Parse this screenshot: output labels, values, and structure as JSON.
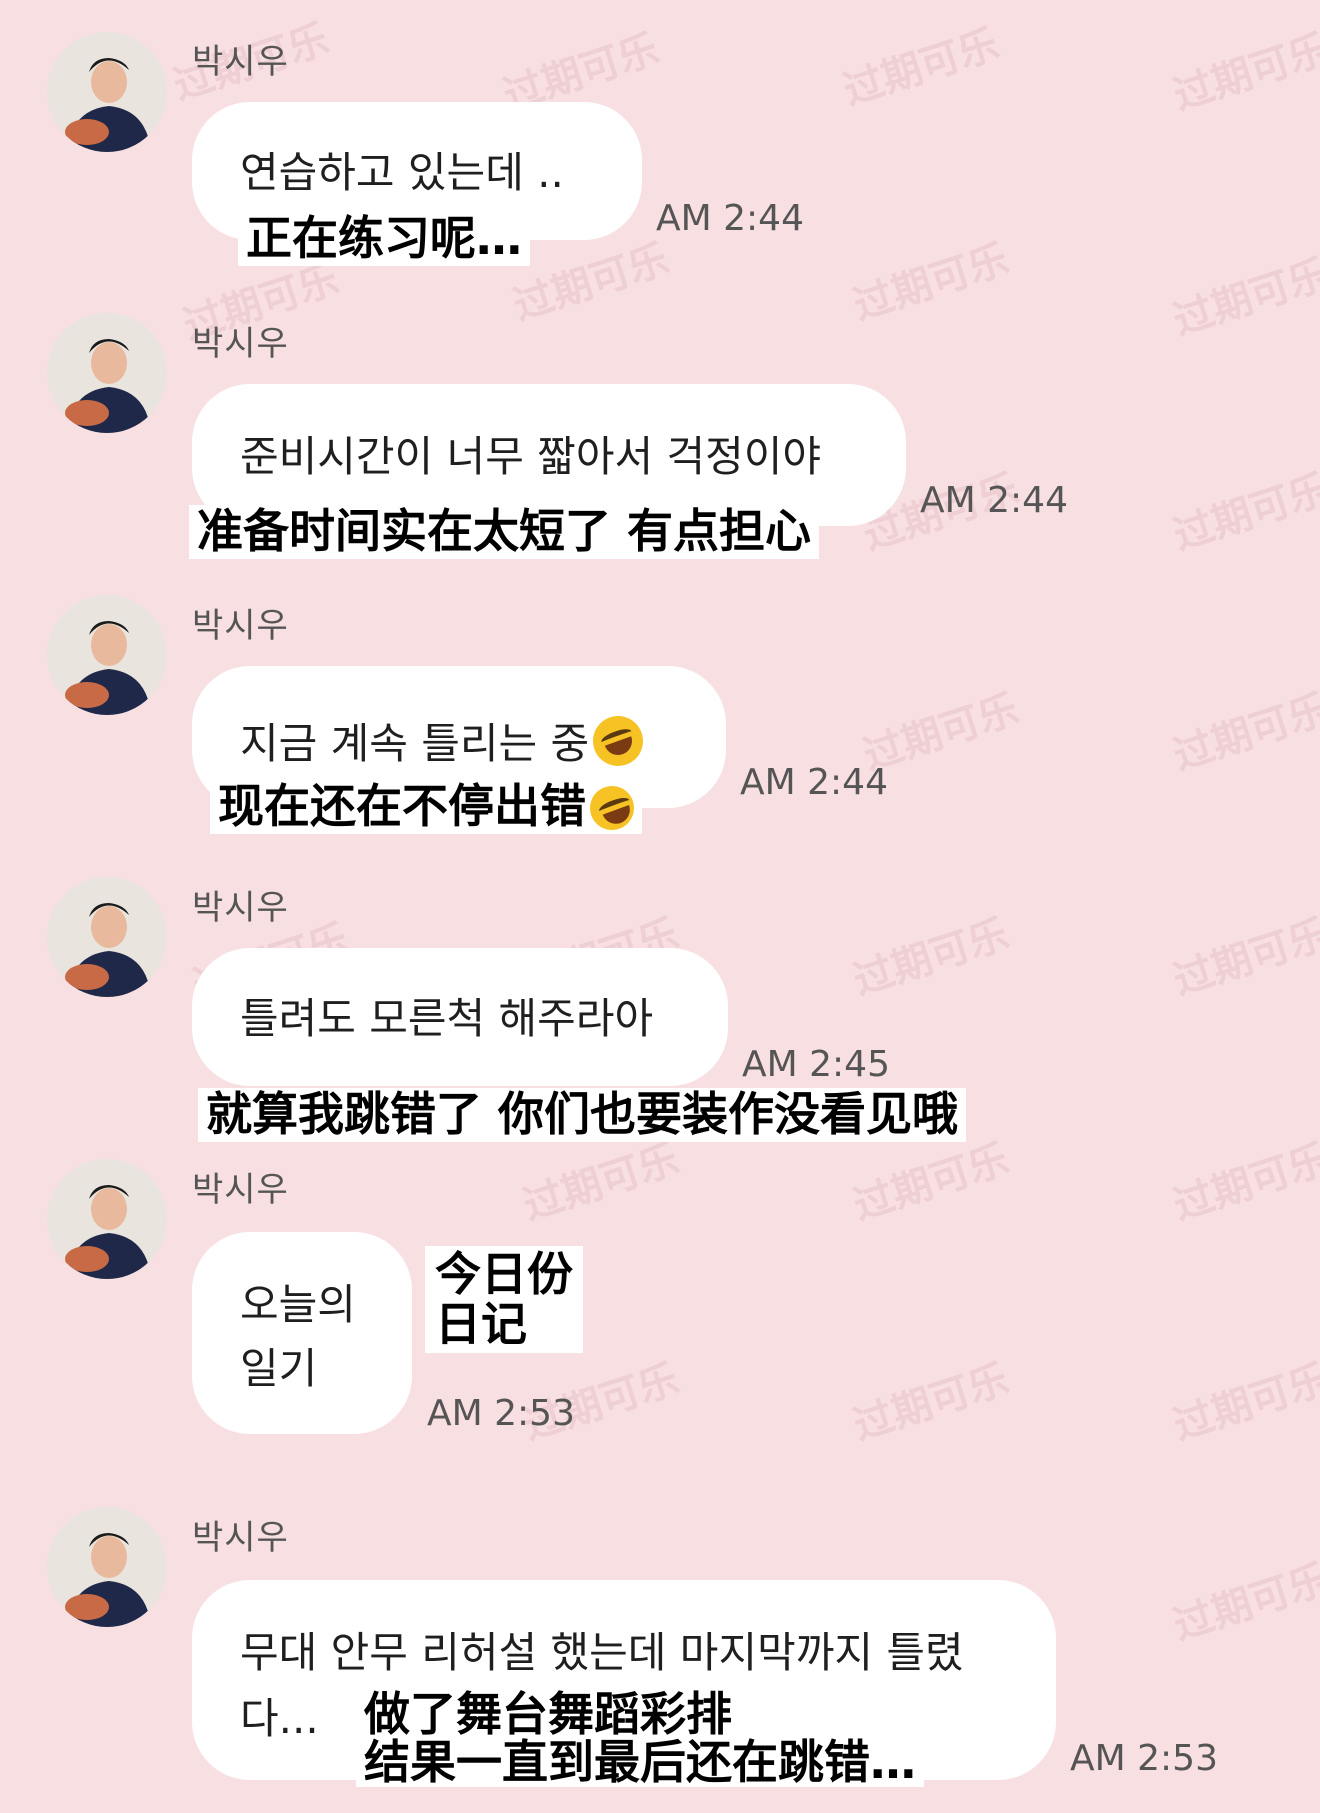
{
  "watermark": "过期可乐",
  "messages": [
    {
      "sender": "박시우",
      "ko": "연습하고 있는데 ..",
      "zh": "正在练习呢…",
      "time": "AM 2:44"
    },
    {
      "sender": "박시우",
      "ko": "준비시간이 너무 짧아서 걱정이야",
      "zh": "准备时间实在太短了 有点担心",
      "time": "AM 2:44"
    },
    {
      "sender": "박시우",
      "ko": "지금 계속 틀리는 중",
      "zh": "现在还在不停出错",
      "time": "AM 2:44",
      "emoji": "rolling-on-floor-laughing-emoji"
    },
    {
      "sender": "박시우",
      "ko": "틀려도 모른척 해주라아",
      "zh": "就算我跳错了 你们也要装作没看见哦",
      "time": "AM 2:45"
    },
    {
      "sender": "박시우",
      "ko_line1": "오늘의",
      "ko_line2": "일기",
      "zh_line1": "今日份",
      "zh_line2": "日记",
      "time": "AM 2:53"
    },
    {
      "sender": "박시우",
      "ko_line1": "무대 안무 리허설 했는데 마지막까지 틀렸",
      "ko_line2": "다...",
      "zh_line1": "做了舞台舞蹈彩排",
      "zh_line2": "结果一直到最后还在跳错…",
      "time": "AM 2:53"
    }
  ]
}
